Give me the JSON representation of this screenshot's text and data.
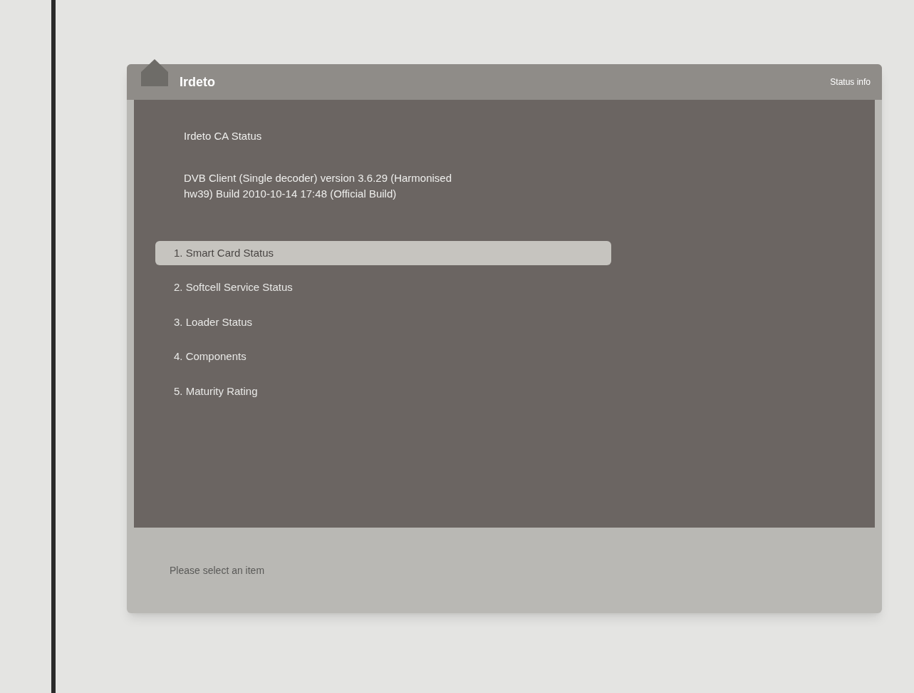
{
  "window": {
    "title": "Irdeto",
    "corner_label": "Status info"
  },
  "heading": "Irdeto CA Status",
  "version_lines": [
    "DVB Client (Single decoder) version 3.6.29 (Harmonised",
    "hw39) Build 2010-10-14 17:48 (Official Build)"
  ],
  "menu": [
    {
      "label": "1. Smart Card Status",
      "selected": true
    },
    {
      "label": "2. Softcell Service Status",
      "selected": false
    },
    {
      "label": "3. Loader Status",
      "selected": false
    },
    {
      "label": "4. Components",
      "selected": false
    },
    {
      "label": "5. Maturity Rating",
      "selected": false
    }
  ],
  "status_bar": "Please select an item"
}
